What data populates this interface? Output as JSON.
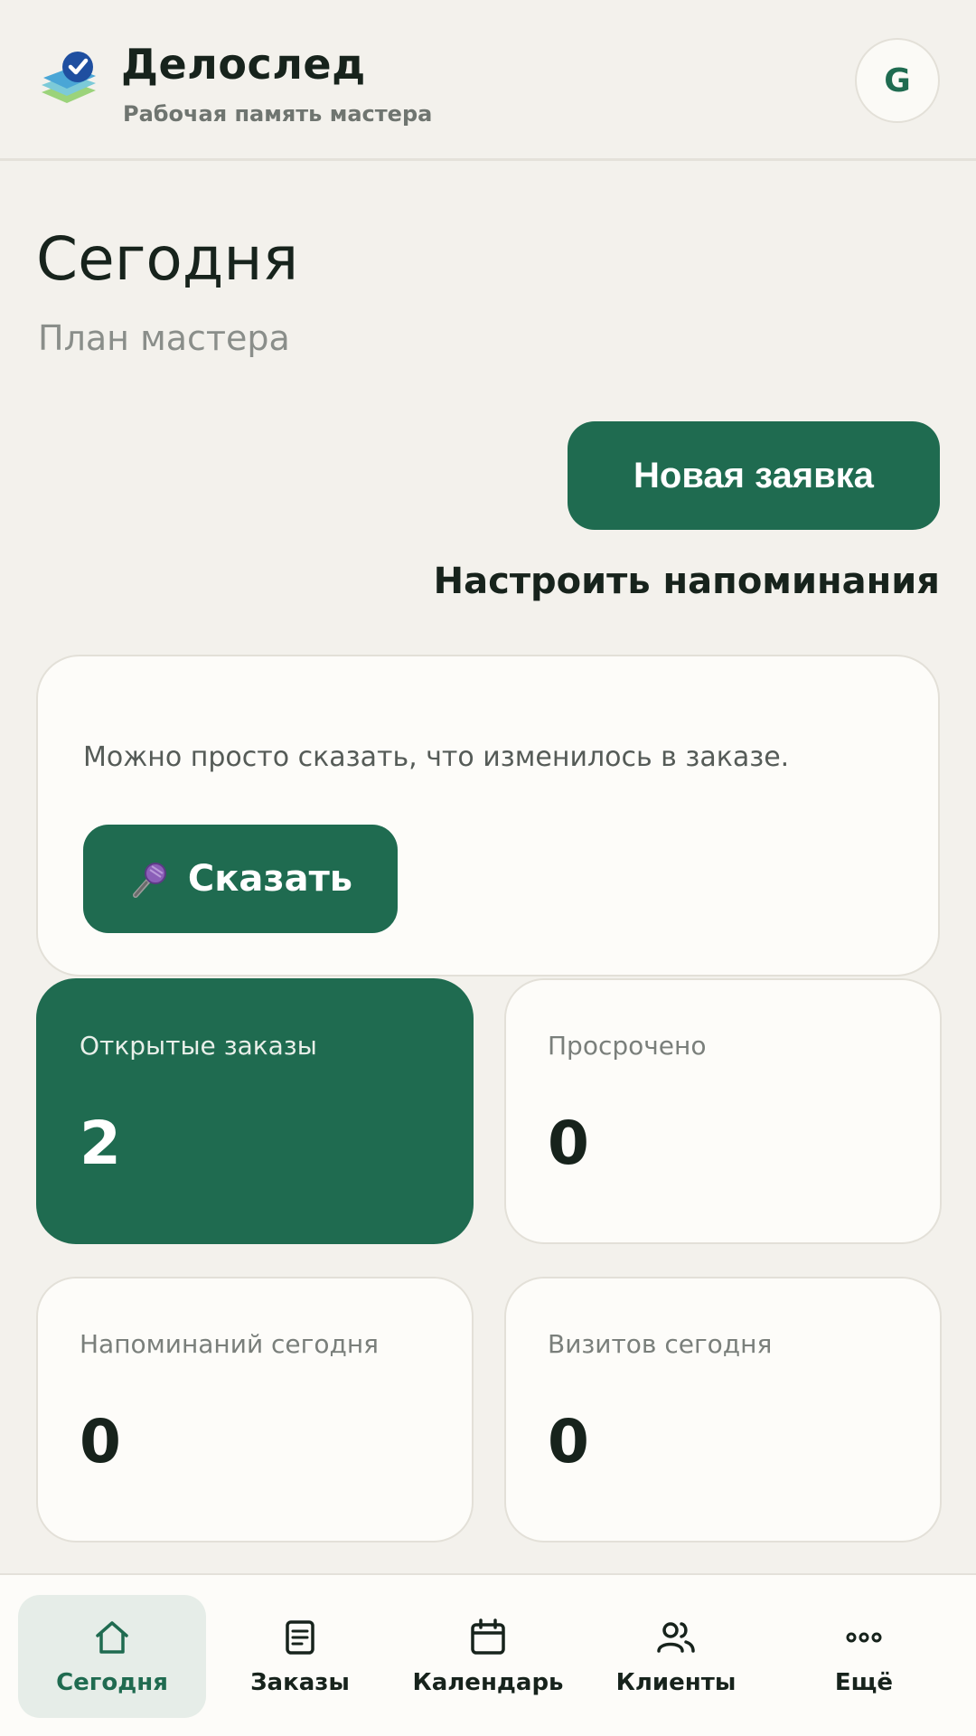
{
  "header": {
    "title": "Делослед",
    "subtitle": "Рабочая память мастера",
    "avatar_letter": "G",
    "logo_icon": "checklist-stack-icon"
  },
  "page": {
    "title": "Сегодня",
    "subtitle": "План мастера"
  },
  "actions": {
    "new_request": "Новая заявка",
    "setup_reminders": "Настроить напоминания"
  },
  "voice": {
    "hint": "Можно просто сказать, что изменилось в заказе.",
    "button_label": "Сказать",
    "icon": "microphone-icon"
  },
  "stats": [
    {
      "label": "Открытые заказы",
      "value": "2",
      "active": true
    },
    {
      "label": "Просрочено",
      "value": "0",
      "active": false
    },
    {
      "label": "Напоминаний сегодня",
      "value": "0",
      "active": false
    },
    {
      "label": "Визитов сегодня",
      "value": "0",
      "active": false
    }
  ],
  "nav": [
    {
      "label": "Сегодня",
      "icon": "home-icon",
      "active": true
    },
    {
      "label": "Заказы",
      "icon": "document-icon",
      "active": false
    },
    {
      "label": "Календарь",
      "icon": "calendar-icon",
      "active": false
    },
    {
      "label": "Клиенты",
      "icon": "users-icon",
      "active": false
    },
    {
      "label": "Ещё",
      "icon": "more-icon",
      "active": false
    }
  ],
  "colors": {
    "accent": "#1f6b50",
    "background": "#f3f1ec",
    "card": "#fdfcf9",
    "text": "#17231c",
    "muted": "#7a7f7b"
  }
}
